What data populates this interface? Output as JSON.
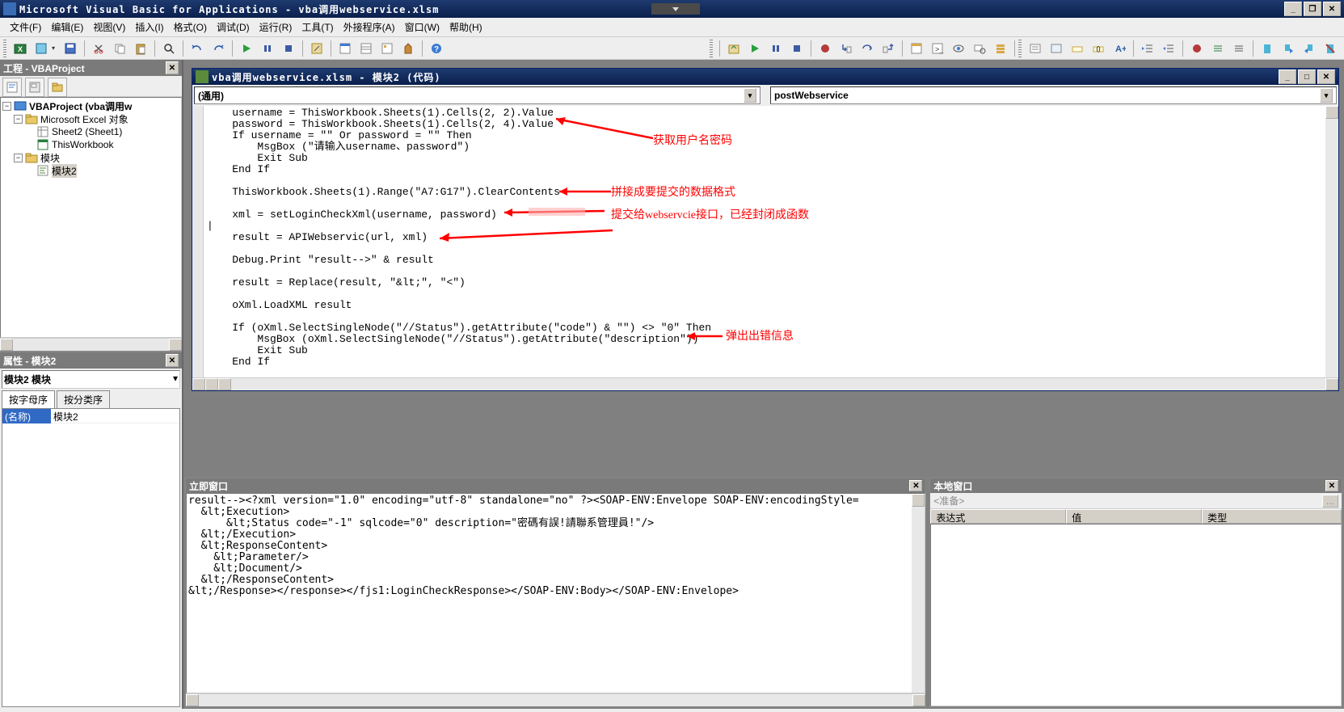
{
  "app_title": "Microsoft Visual Basic for Applications - vba调用webservice.xlsm",
  "menu": {
    "file": "文件(F)",
    "edit": "编辑(E)",
    "view": "视图(V)",
    "insert": "插入(I)",
    "format": "格式(O)",
    "debug": "调试(D)",
    "run": "运行(R)",
    "tools": "工具(T)",
    "addins": "外接程序(A)",
    "window": "窗口(W)",
    "help": "帮助(H)"
  },
  "project_panel": {
    "title": "工程 - VBAProject",
    "tree": {
      "root": "VBAProject (vba调用w",
      "excel_objects": "Microsoft Excel 对象",
      "sheet2": "Sheet2 (Sheet1)",
      "thisworkbook": "ThisWorkbook",
      "modules": "模块",
      "module2": "模块2"
    }
  },
  "props_panel": {
    "title": "属性 - 模块2",
    "object_type": "模块2 模块",
    "tab_alpha": "按字母序",
    "tab_cat": "按分类序",
    "prop_name_label": "(名称)",
    "prop_name_value": "模块2"
  },
  "code_window": {
    "title": "vba调用webservice.xlsm - 模块2 (代码)",
    "dd_object": "(通用)",
    "dd_proc": "postWebservice",
    "code": "    username = ThisWorkbook.Sheets(1).Cells(2, 2).Value\n    password = ThisWorkbook.Sheets(1).Cells(2, 4).Value\n    If username = \"\" Or password = \"\" Then\n        MsgBox (\"请输入username、password\")\n        Exit Sub\n    End If\n    \n    ThisWorkbook.Sheets(1).Range(\"A7:G17\").ClearContents\n    \n    xml = setLoginCheckXml(username, password)\n|\n    result = APIWebservic(url, xml)\n\n    Debug.Print \"result-->\" & result\n\n    result = Replace(result, \"&lt;\", \"<\")\n    \n    oXml.LoadXML result\n    \n    If (oXml.SelectSingleNode(\"//Status\").getAttribute(\"code\") & \"\") <> \"0\" Then\n        MsgBox (oXml.SelectSingleNode(\"//Status\").getAttribute(\"description\"))\n        Exit Sub\n    End If"
  },
  "annotations": {
    "a1": "获取用户名密码",
    "a2": "拼接成要提交的数据格式",
    "a3": "提交给webservcie接口，已经封闭成函数",
    "a4": "弹出出错信息"
  },
  "immediate_window": {
    "title": "立即窗口",
    "text": "result--><?xml version=\"1.0\" encoding=\"utf-8\" standalone=\"no\" ?><SOAP-ENV:Envelope SOAP-ENV:encodingStyle=\n  &lt;Execution>\n      &lt;Status code=\"-1\" sqlcode=\"0\" description=\"密碼有誤!請聯系管理員!\"/>\n  &lt;/Execution>\n  &lt;ResponseContent>\n    &lt;Parameter/>\n    &lt;Document/>\n  &lt;/ResponseContent>\n&lt;/Response></response></fjs1:LoginCheckResponse></SOAP-ENV:Body></SOAP-ENV:Envelope>"
  },
  "locals_window": {
    "title": "本地窗口",
    "ready": "<准备>",
    "col_expr": "表达式",
    "col_val": "值",
    "col_type": "类型"
  }
}
